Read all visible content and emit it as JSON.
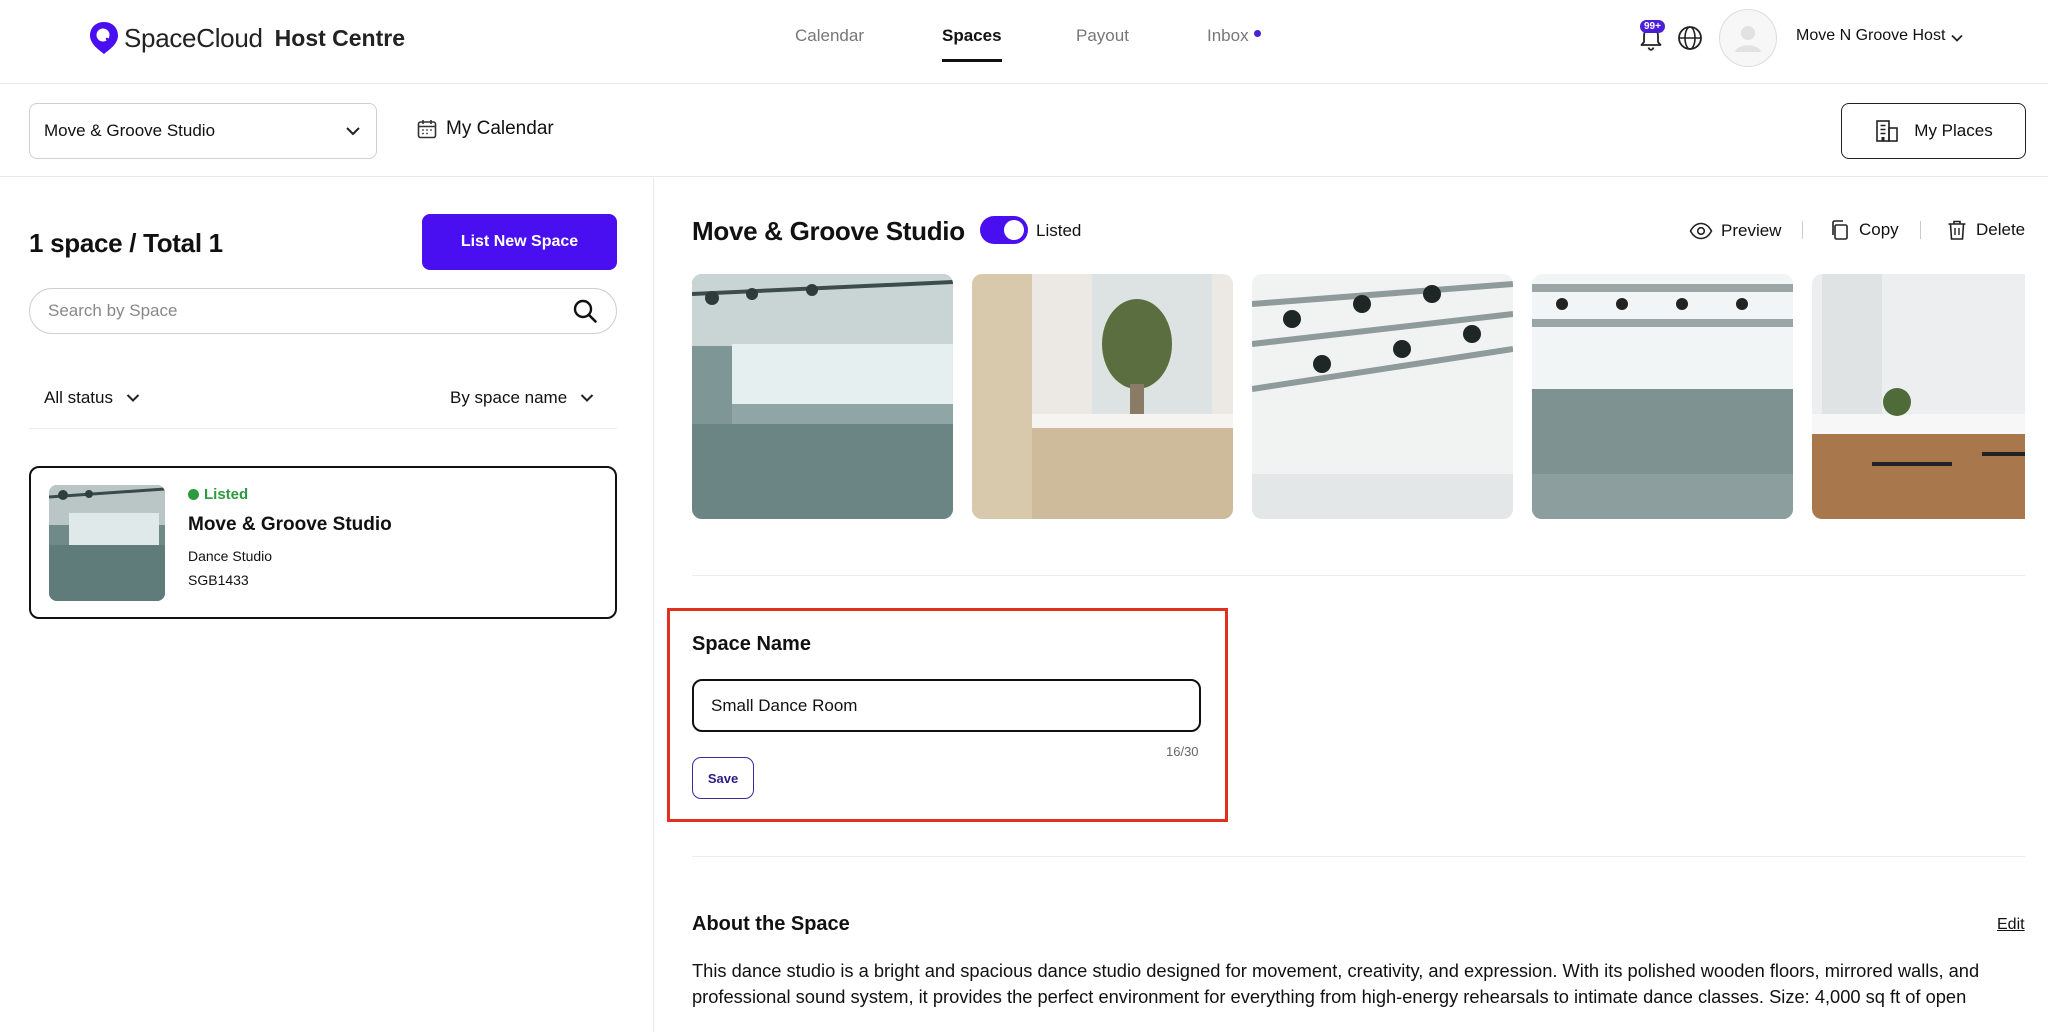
{
  "brand": {
    "name": "SpaceCloud",
    "section": "Host Centre",
    "accent": "#4a0ff0"
  },
  "nav": {
    "tabs": [
      {
        "label": "Calendar",
        "active": false
      },
      {
        "label": "Spaces",
        "active": true
      },
      {
        "label": "Payout",
        "active": false
      },
      {
        "label": "Inbox",
        "active": false
      }
    ],
    "notification_badge": "99+",
    "user_name": "Move N Groove Host"
  },
  "subheader": {
    "selected_studio": "Move & Groove Studio",
    "my_calendar": "My Calendar",
    "my_places": "My Places"
  },
  "left": {
    "count_title": "1 space / Total 1",
    "list_new_button": "List New Space",
    "search_placeholder": "Search by Space",
    "status_filter": "All status",
    "sort_filter": "By space name",
    "cards": [
      {
        "status": "Listed",
        "title": "Move & Groove Studio",
        "type": "Dance Studio",
        "code": "SGB1433"
      }
    ]
  },
  "main": {
    "title": "Move & Groove Studio",
    "listed_label": "Listed",
    "listed_on": true,
    "actions": {
      "preview": "Preview",
      "copy": "Copy",
      "delete": "Delete"
    },
    "space_name": {
      "label": "Space Name",
      "value": "Small Dance Room",
      "char_count": "16/30",
      "save_label": "Save"
    },
    "about": {
      "title": "About the Space",
      "edit_label": "Edit",
      "text": "This dance studio is a bright and spacious dance studio designed for movement, creativity, and expression. With its polished wooden floors, mirrored walls, and professional sound system, it provides the perfect environment for everything from high-energy rehearsals to intimate dance classes. Size: 4,000 sq ft of open"
    }
  },
  "colors": {
    "listed_green": "#2c9a3f",
    "highlight_red": "#e0301e"
  }
}
